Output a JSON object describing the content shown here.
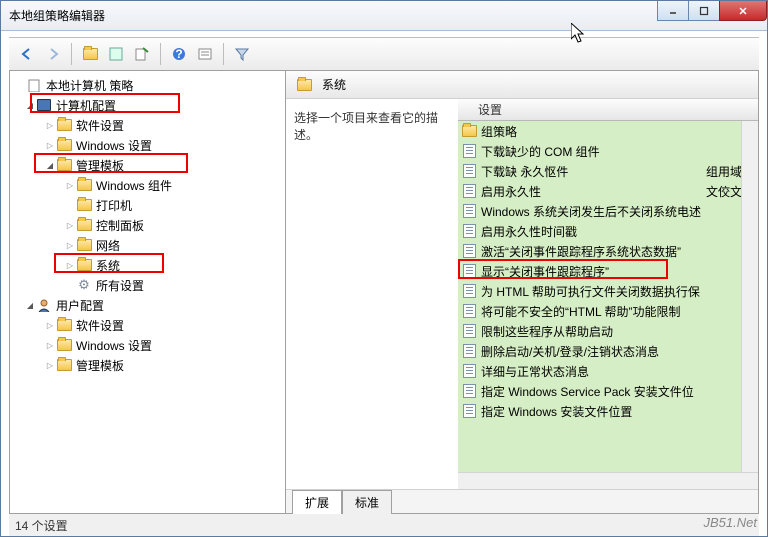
{
  "window": {
    "title": "本地组策略编辑器"
  },
  "tree": {
    "root": "本地计算机 策略",
    "computer_config": "计算机配置",
    "software_settings": "软件设置",
    "windows_settings": "Windows 设置",
    "admin_templates": "管理模板",
    "windows_components": "Windows 组件",
    "printers": "打印机",
    "control_panel": "控制面板",
    "network": "网络",
    "system": "系统",
    "all_settings": "所有设置",
    "user_config": "用户配置",
    "u_software": "软件设置",
    "u_windows": "Windows 设置",
    "u_admin": "管理模板"
  },
  "right": {
    "header": "系统",
    "desc": "选择一个项目来查看它的描述。",
    "col_setting": "设置",
    "col_state1": "组用域资",
    "col_state2": "文佼文件"
  },
  "settings": [
    {
      "label": "组策略"
    },
    {
      "label": "下载缺少的 COM 组件"
    },
    {
      "label": "下载缺 永久怄件"
    },
    {
      "label": "启用永久性"
    },
    {
      "label": "Windows 系统关闭发生后不关闭系统电述"
    },
    {
      "label": "启用永久性时间戳"
    },
    {
      "label": "激活“关闭事件跟踪程序系统状态数据”"
    },
    {
      "label": "显示“关闭事件跟踪程序”"
    },
    {
      "label": "为 HTML 帮助可执行文件关闭数据执行保"
    },
    {
      "label": "将可能不安全的“HTML 帮助”功能限制"
    },
    {
      "label": "限制这些程序从帮助启动"
    },
    {
      "label": "删除启动/关机/登录/注销状态消息"
    },
    {
      "label": "详细与正常状态消息"
    },
    {
      "label": "指定 Windows Service Pack 安装文件位"
    },
    {
      "label": "指定 Windows 安装文件位置"
    }
  ],
  "tabs": {
    "extended": "扩展",
    "standard": "标准"
  },
  "status": "14 个设置",
  "watermark": "JB51.Net"
}
